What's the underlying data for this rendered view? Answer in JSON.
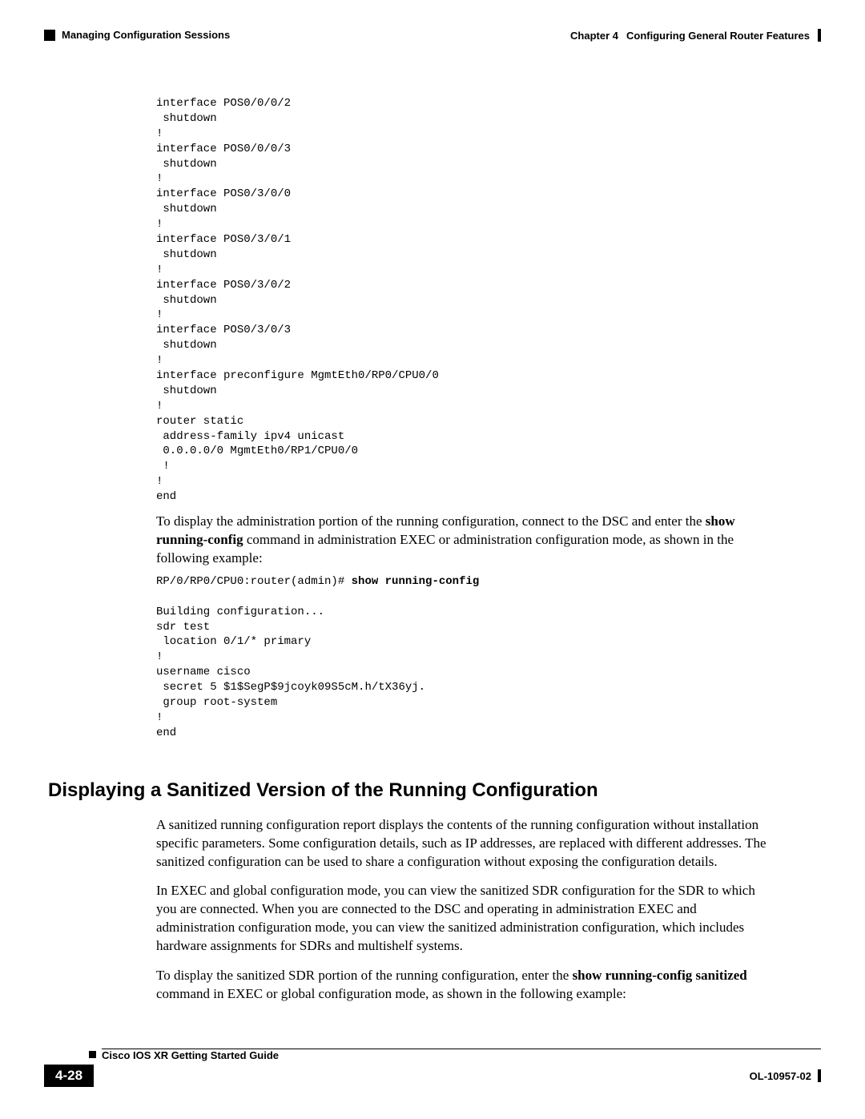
{
  "header": {
    "chapter": "Chapter 4",
    "chapter_title": "Configuring General Router Features",
    "section": "Managing Configuration Sessions"
  },
  "code_block_1": "interface POS0/0/0/2\n shutdown\n!\ninterface POS0/0/0/3\n shutdown\n!\ninterface POS0/3/0/0\n shutdown\n!\ninterface POS0/3/0/1\n shutdown\n!\ninterface POS0/3/0/2\n shutdown\n!\ninterface POS0/3/0/3\n shutdown\n!\ninterface preconfigure MgmtEth0/RP0/CPU0/0\n shutdown\n!\nrouter static\n address-family ipv4 unicast\n 0.0.0.0/0 MgmtEth0/RP1/CPU0/0\n !\n!\nend",
  "para1_a": "To display the administration portion of the running configuration, connect to the DSC and enter the ",
  "para1_b": "show running-config",
  "para1_c": " command in administration EXEC or administration configuration mode, as shown in the following example:",
  "code2_prompt": "RP/0/RP0/CPU0:router(admin)# ",
  "code2_cmd": "show running-config",
  "code_block_2": "\n\nBuilding configuration...\nsdr test\n location 0/1/* primary\n!\nusername cisco\n secret 5 $1$SegP$9jcoyk09S5cM.h/tX36yj.\n group root-system\n!\nend",
  "heading": "Displaying a Sanitized Version of the Running Configuration",
  "para2": "A sanitized running configuration report displays the contents of the running configuration without installation specific parameters. Some configuration details, such as IP addresses, are replaced with different addresses. The sanitized configuration can be used to share a configuration without exposing the configuration details.",
  "para3": "In EXEC and global configuration mode, you can view the sanitized SDR configuration for the SDR to which you are connected. When you are connected to the DSC and operating in administration EXEC and administration configuration mode, you can view the sanitized administration configuration, which includes hardware assignments for SDRs and multishelf systems.",
  "para4_a": "To display the sanitized SDR portion of the running configuration, enter the ",
  "para4_b": "show running-config sanitized",
  "para4_c": " command in EXEC or global configuration mode, as shown in the following example:",
  "footer": {
    "guide": "Cisco IOS XR Getting Started Guide",
    "page": "4-28",
    "doc": "OL-10957-02"
  }
}
